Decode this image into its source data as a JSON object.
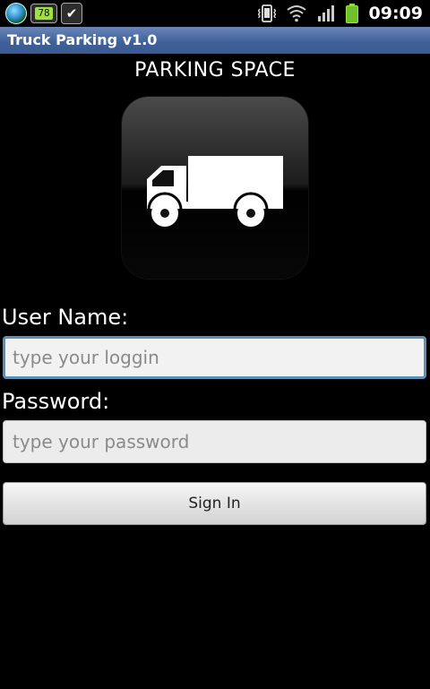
{
  "status_bar": {
    "time": "09:09",
    "battery_badge_text": "78",
    "icons": [
      "globe-icon",
      "battery-widget-icon",
      "checkmark-icon",
      "vibrate-icon",
      "wifi-icon",
      "signal-icon",
      "battery-icon"
    ]
  },
  "title_bar": {
    "title": "Truck Parking v1.0"
  },
  "brand": {
    "heading": "PARKING SPACE",
    "logo_icon": "truck-icon"
  },
  "form": {
    "username_label": "User Name:",
    "username_placeholder": "type your loggin",
    "password_label": "Password:",
    "password_placeholder": "type your password",
    "signin_label": "Sign In"
  },
  "colors": {
    "background": "#000000",
    "title_bar": "#3e5f98",
    "focus_border": "#5a90b8",
    "field_background": "#ececec"
  }
}
